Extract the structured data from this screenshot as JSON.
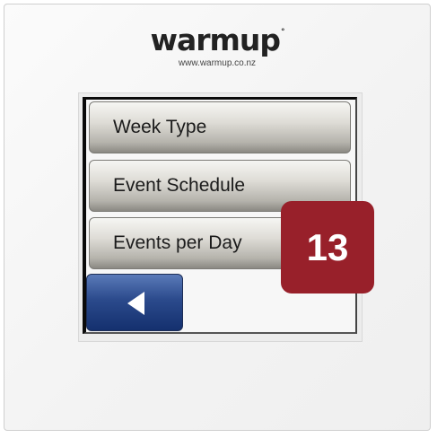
{
  "brand": {
    "logo_text": "warmup",
    "logo_mark": "°",
    "url": "www.warmup.co.nz"
  },
  "menu": {
    "items": [
      {
        "label": "Week Type"
      },
      {
        "label": "Event Schedule"
      },
      {
        "label": "Events per Day"
      }
    ],
    "back_icon": "left-arrow-icon"
  },
  "callout": {
    "number": "13",
    "color": "#98202a"
  },
  "colors": {
    "back_button": "#2b4a8c",
    "menu_button": "#dedcd6"
  }
}
